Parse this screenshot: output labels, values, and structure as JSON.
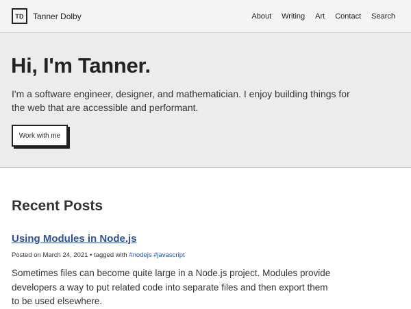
{
  "header": {
    "logo_text": "TD",
    "site_name": "Tanner Dolby",
    "nav": [
      "About",
      "Writing",
      "Art",
      "Contact",
      "Search"
    ]
  },
  "hero": {
    "title": "Hi, I'm Tanner.",
    "description": "I'm a software engineer, designer, and mathematician. I enjoy building things for the web that are accessible and performant.",
    "button_label": "Work with me"
  },
  "posts": {
    "heading": "Recent Posts",
    "items": [
      {
        "title": "Using Modules in Node.js",
        "posted_prefix": "Posted on",
        "date": "March 24, 2021",
        "tagged_prefix": "• tagged with",
        "tags": [
          "#nodejs",
          "#javascript"
        ],
        "excerpt": "Sometimes files can become quite large in a Node.js project. Modules provide developers a way to put related code into separate files and then export them to be used elsewhere."
      }
    ]
  },
  "colors": {
    "link": "#2b50a1",
    "header_bg": "#f4f4f4",
    "hero_bg": "#ececec",
    "text": "#222222"
  }
}
